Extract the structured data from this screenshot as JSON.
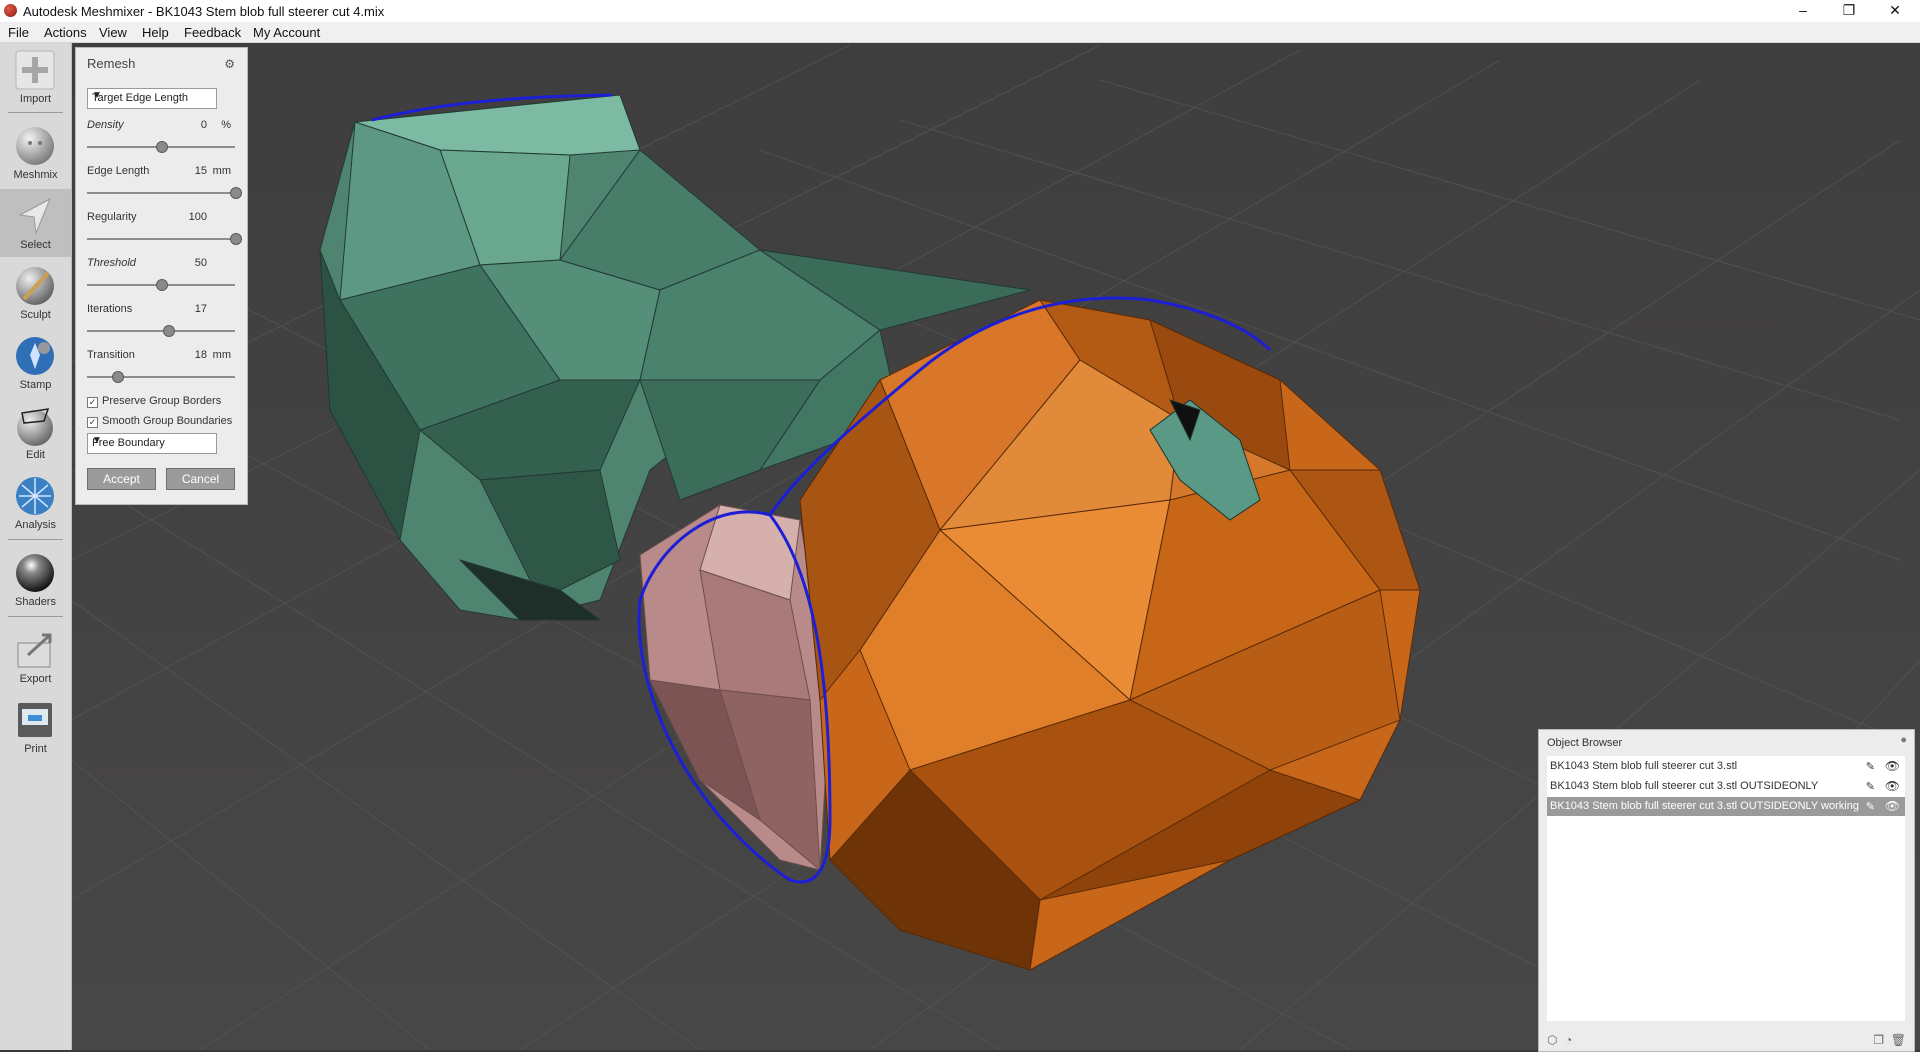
{
  "window": {
    "title": "Autodesk Meshmixer - BK1043 Stem blob full steerer cut 4.mix",
    "controls": {
      "minimize": "–",
      "restore": "❐",
      "close": "✕"
    }
  },
  "menu": [
    "File",
    "Actions",
    "View",
    "Help",
    "Feedback",
    "My Account"
  ],
  "toolbar": {
    "tools": [
      {
        "label": "Import",
        "icon": "plus-icon"
      },
      {
        "label": "Meshmix",
        "icon": "meshmix-sphere-icon"
      },
      {
        "label": "Select",
        "icon": "select-arrow-icon",
        "active": true
      },
      {
        "label": "Sculpt",
        "icon": "sculpt-brush-icon"
      },
      {
        "label": "Stamp",
        "icon": "stamp-icon"
      },
      {
        "label": "Edit",
        "icon": "edit-icon"
      },
      {
        "label": "Analysis",
        "icon": "analysis-icon"
      },
      {
        "label": "Shaders",
        "icon": "shaders-sphere-icon"
      },
      {
        "label": "Export",
        "icon": "export-icon"
      },
      {
        "label": "Print",
        "icon": "print-icon"
      }
    ]
  },
  "remesh": {
    "title": "Remesh",
    "mode": "Target Edge Length",
    "params": [
      {
        "name": "Density",
        "value": "0",
        "unit": "%",
        "italic": true,
        "fraction": 0.5
      },
      {
        "name": "Edge Length",
        "value": "15",
        "unit": "mm",
        "italic": false,
        "fraction": 1.0
      },
      {
        "name": "Regularity",
        "value": "100",
        "unit": "",
        "italic": false,
        "fraction": 1.0
      },
      {
        "name": "Threshold",
        "value": "50",
        "unit": "",
        "italic": true,
        "fraction": 0.5
      },
      {
        "name": "Iterations",
        "value": "17",
        "unit": "",
        "italic": false,
        "fraction": 0.55
      },
      {
        "name": "Transition",
        "value": "18",
        "unit": "mm",
        "italic": false,
        "fraction": 0.2
      }
    ],
    "preserve_group_borders": "Preserve Group Borders",
    "smooth_group_boundaries": "Smooth Group Boundaries",
    "boundary_mode": "Free Boundary",
    "accept": "Accept",
    "cancel": "Cancel"
  },
  "object_browser": {
    "title": "Object Browser",
    "items": [
      {
        "name": "BK1043 Stem blob full steerer cut 3.stl",
        "selected": false
      },
      {
        "name": "BK1043 Stem blob full steerer cut 3.stl OUTSIDEONLY",
        "selected": false
      },
      {
        "name": "BK1043 Stem blob full steerer cut 3.stl OUTSIDEONLY working",
        "selected": true
      }
    ]
  },
  "colors": {
    "viewport_bg": "#414040",
    "mesh_green": "#4f8570",
    "mesh_orange": "#c8661a",
    "mesh_pink": "#b88b8a",
    "boundary_blue": "#1c1fd6"
  }
}
